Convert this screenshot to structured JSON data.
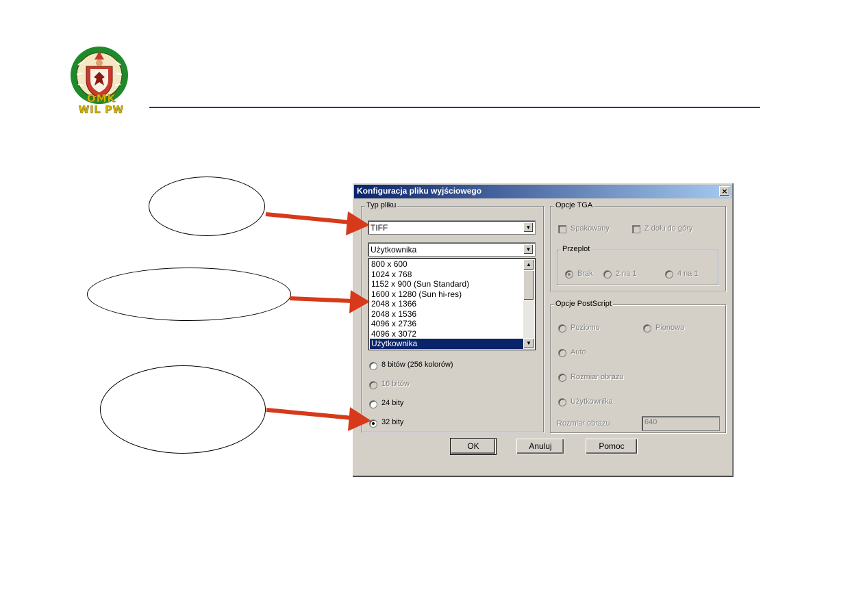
{
  "header": {
    "logo_line1": "OMK",
    "logo_line2": "WIL PW",
    "rule_color": "#2b2bb0"
  },
  "dialog": {
    "title": "Konfiguracja pliku wyjściowego",
    "close_label": "×",
    "file_type": {
      "group_label": "Typ pliku",
      "selected": "TIFF",
      "resolution_selected": "Użytkownika",
      "resolution_options": [
        "800 x 600",
        "1024 x 768",
        "1152 x 900 (Sun Standard)",
        "1600 x 1280 (Sun hi-res)",
        "2048 x 1366",
        "2048 x 1536",
        "4096 x 2736",
        "4096 x 3072",
        "Użytkownika"
      ],
      "color_depth": [
        {
          "label": "8 bitów (256 kolorów)",
          "checked": false,
          "enabled": true
        },
        {
          "label": "16 bitów",
          "checked": false,
          "enabled": false
        },
        {
          "label": "24 bity",
          "checked": false,
          "enabled": true
        },
        {
          "label": "32 bity",
          "checked": true,
          "enabled": true
        }
      ]
    },
    "tga_options": {
      "group_label": "Opcje TGA",
      "packed_label": "Spakowany",
      "bottom_up_label": "Z dołu do góry",
      "interlace": {
        "group_label": "Przeplot",
        "options": [
          "Brak",
          "2 na 1",
          "4 na 1"
        ]
      }
    },
    "postscript_options": {
      "group_label": "Opcje PostScript",
      "horizontal_label": "Poziomo",
      "vertical_label": "Pionowo",
      "auto_label": "Auto",
      "image_size_label": "Rozmiar obrazu",
      "user_label": "Użytkownika",
      "size_field_label": "Rozmiar obrazu",
      "size_value": "640"
    },
    "buttons": {
      "ok": "OK",
      "cancel": "Anuluj",
      "help": "Pomoc"
    }
  },
  "colors": {
    "arrow": "#d63a1a",
    "titlebar_start": "#0a246a",
    "titlebar_end": "#a6caf0",
    "selection": "#0a246a"
  }
}
